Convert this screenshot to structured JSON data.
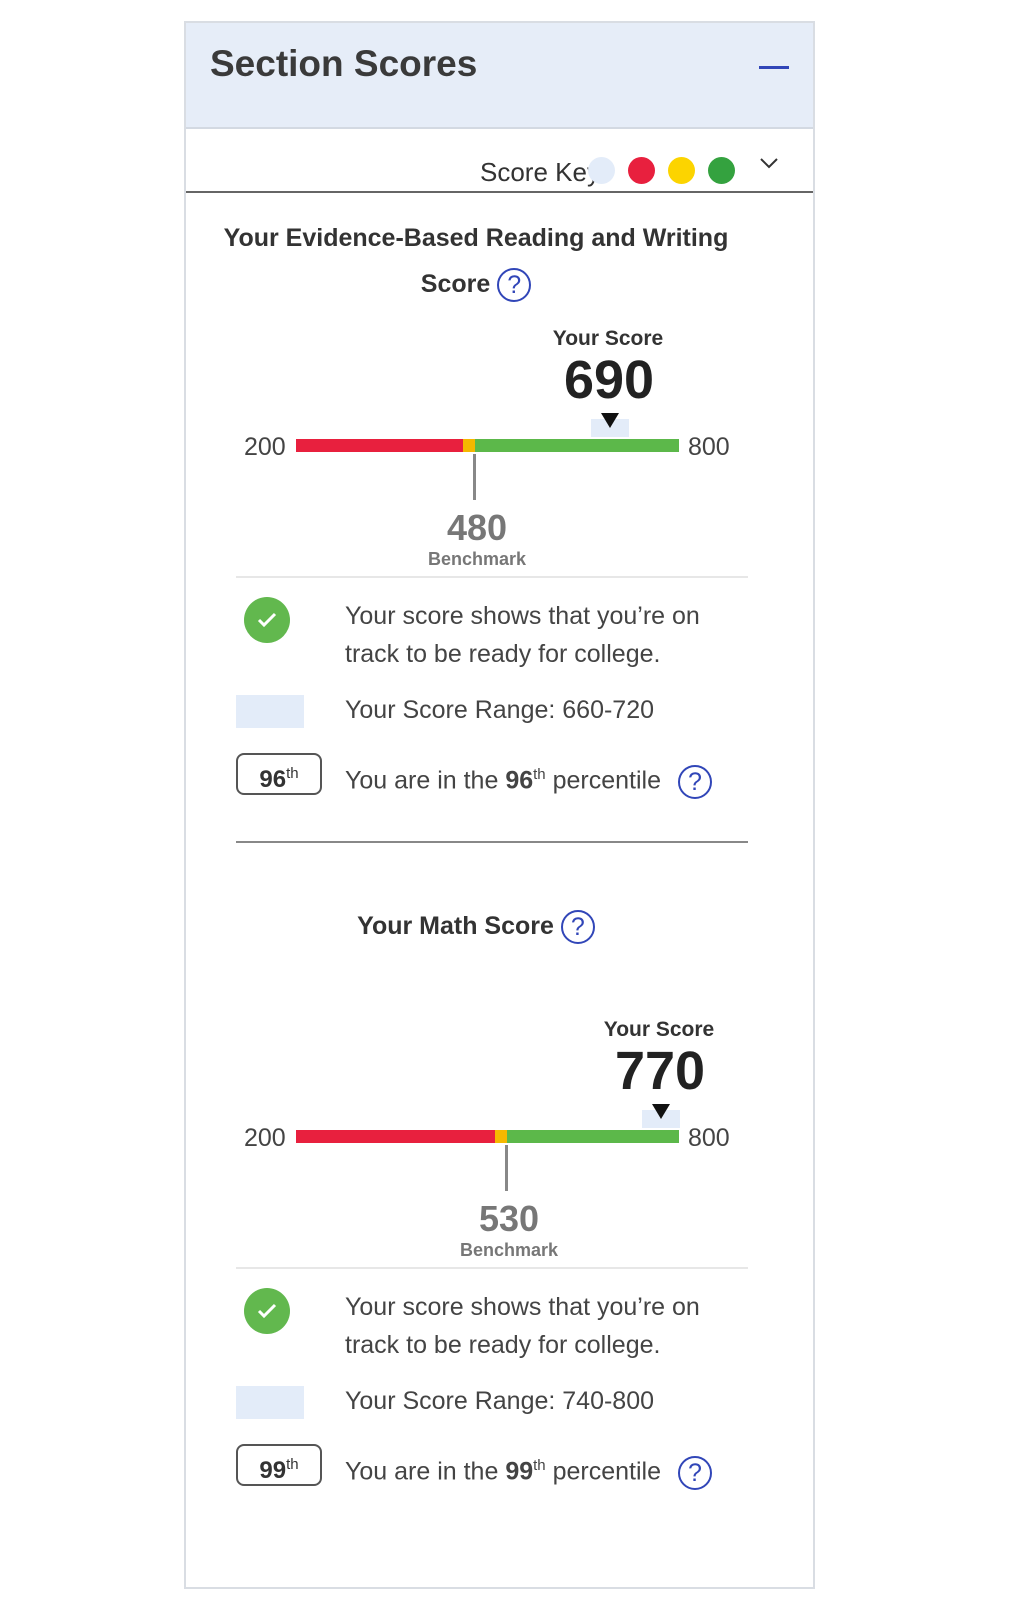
{
  "header": {
    "title": "Section Scores",
    "collapse_icon": "minus-icon"
  },
  "score_key": {
    "label": "Score Key",
    "dots": [
      "#e3ecf9",
      "#e8203e",
      "#fcd400",
      "#34a23f"
    ]
  },
  "colors": {
    "red": "#e8203e",
    "yellow": "#f5b800",
    "green": "#5cb84a",
    "accent": "#3146b8",
    "range": "#e3ecf9"
  },
  "sections": [
    {
      "title_line1": "Your Evidence-Based Reading and Writing",
      "title_line2": "Score",
      "your_score_label": "Your Score",
      "score": "690",
      "scale_min": "200",
      "scale_max": "800",
      "benchmark": "480",
      "benchmark_label": "Benchmark",
      "status_line1": "Your score shows that you’re on",
      "status_line2": "track to be ready for college.",
      "range_text": "Your Score Range: 660-720",
      "percentile": "96",
      "percentile_suffix": "th",
      "percentile_prefix": "You are in the ",
      "percentile_word": " percentile"
    },
    {
      "title_line1": "Your Math Score",
      "your_score_label": "Your Score",
      "score": "770",
      "scale_min": "200",
      "scale_max": "800",
      "benchmark": "530",
      "benchmark_label": "Benchmark",
      "status_line1": "Your score shows that you’re on",
      "status_line2": "track to be ready for college.",
      "range_text": "Your Score Range: 740-800",
      "percentile": "99",
      "percentile_suffix": "th",
      "percentile_prefix": "You are in the ",
      "percentile_word": " percentile"
    }
  ]
}
